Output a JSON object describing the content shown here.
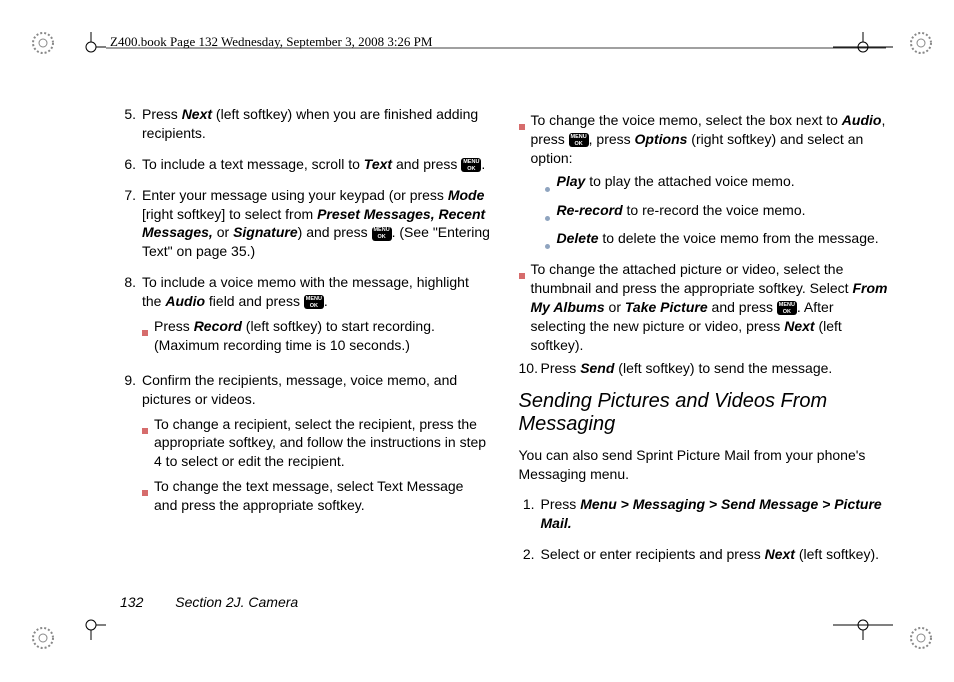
{
  "header": "Z400.book  Page 132  Wednesday, September 3, 2008  3:26 PM",
  "menuok": {
    "line1": "MENU",
    "line2": "OK"
  },
  "steps_left": [
    {
      "n": "5.",
      "pre": "Press ",
      "b1": "Next",
      "post": " (left softkey) when you are finished adding recipients."
    },
    {
      "n": "6.",
      "pre": "To include a text message, scroll to ",
      "b1": "Text",
      "post": " and press ",
      "icon_after": true,
      "post2": "."
    },
    {
      "n": "7.",
      "pre": "Enter your message using your keypad (or press ",
      "b1": "Mode",
      "mid1": " [right softkey] to select from ",
      "b2": "Preset Messages, Recent Messages,",
      "mid2": " or ",
      "b3": "Signature",
      "post": ") and press ",
      "icon_after": true,
      "post2": ". (See \"Entering Text\" on page 35.)"
    },
    {
      "n": "8.",
      "pre": "To include a voice memo with the message, highlight the ",
      "b1": "Audio",
      "post": " field and press ",
      "icon_after": true,
      "post2": ".",
      "subs": [
        {
          "pre": "Press ",
          "b1": "Record",
          "post": " (left softkey) to start recording. (Maximum recording time is 10 seconds.)"
        }
      ]
    },
    {
      "n": "9.",
      "pre": "Confirm the recipients, message, voice memo, and pictures or videos.",
      "subs": [
        {
          "text": "To change a recipient, select the recipient, press the appropriate softkey, and follow the instructions in step 4 to select or edit the recipient."
        },
        {
          "text": "To change the text message, select Text Message and press the appropriate softkey."
        }
      ]
    }
  ],
  "right_subs_top": [
    {
      "pre": "To change the voice memo, select the box next to ",
      "b1": "Audio",
      "mid": ", press ",
      "icon": true,
      "mid2": ", press ",
      "b2": "Options",
      "post": " (right softkey) and select an option:",
      "bullets": [
        {
          "b": "Play",
          "post": " to play the attached voice memo."
        },
        {
          "b": "Re-record",
          "post": " to re-record the voice memo."
        },
        {
          "b": "Delete",
          "post": " to delete the voice memo from the message."
        }
      ]
    },
    {
      "pre": "To change the attached picture or video, select the thumbnail and press the appropriate softkey. Select ",
      "b1": "From My Albums",
      "mid": " or ",
      "b2": "Take Picture",
      "mid2": " and press ",
      "icon": true,
      "post": ". After selecting the new picture or video, press ",
      "b3": "Next",
      "post2": " (left softkey)."
    }
  ],
  "step10": {
    "n": "10.",
    "pre": "Press ",
    "b1": "Send",
    "post": " (left softkey) to send the message."
  },
  "section_heading": "Sending Pictures and Videos From Messaging",
  "section_para": "You can also send Sprint Picture Mail from your phone's Messaging menu.",
  "steps_right": [
    {
      "n": "1.",
      "pre": "Press ",
      "b1": "Menu > Messaging > Send Message > Picture Mail.",
      "post": ""
    },
    {
      "n": "2.",
      "pre": "Select or enter recipients and press ",
      "b1": "Next",
      "post": " (left softkey)."
    }
  ],
  "footer": {
    "page": "132",
    "section": "Section 2J. Camera"
  }
}
